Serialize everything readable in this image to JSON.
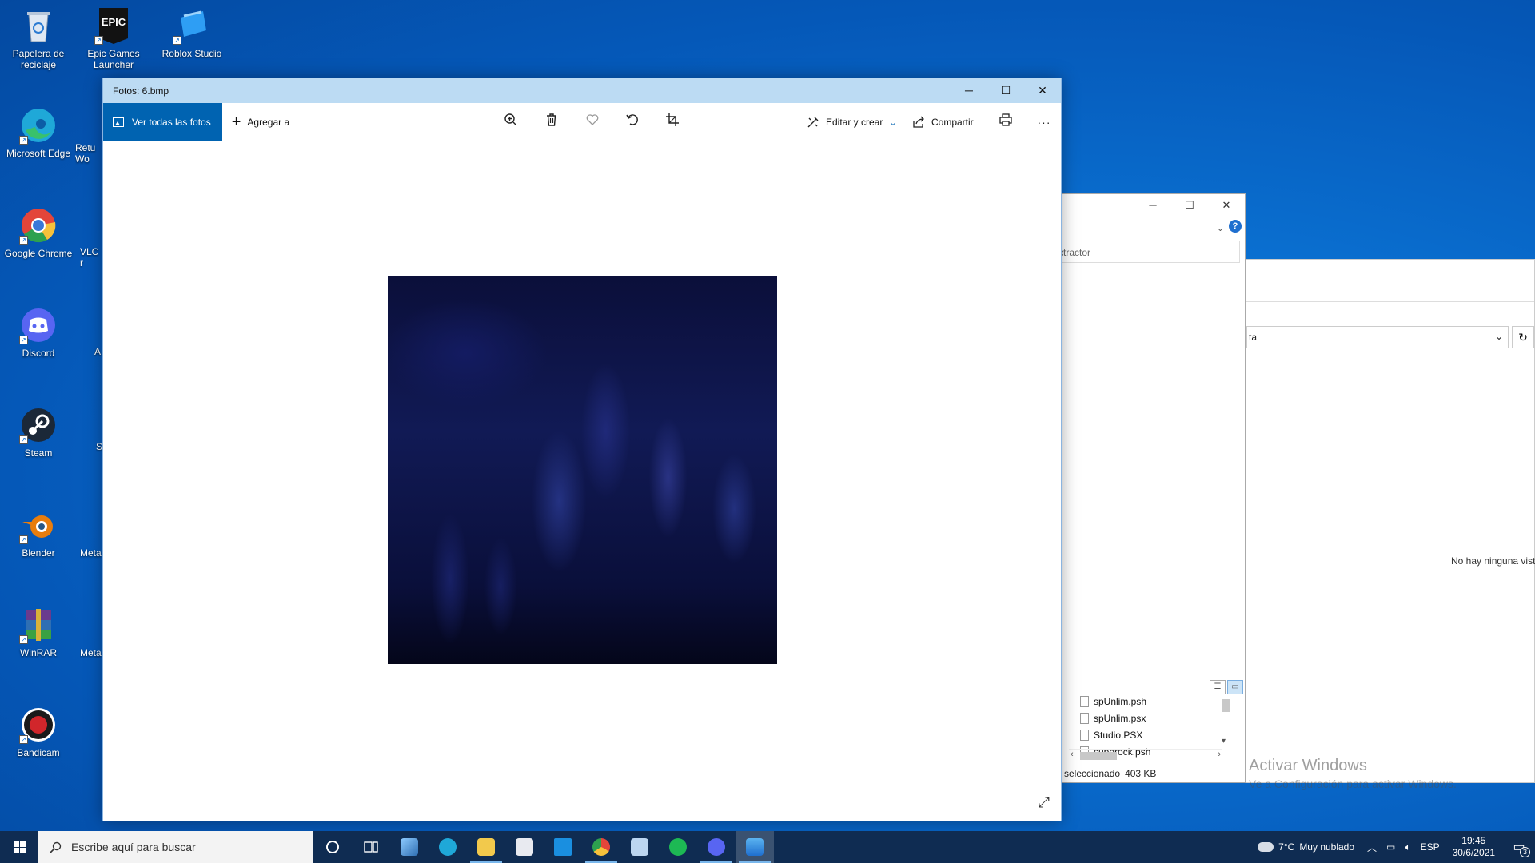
{
  "desktop": {
    "icons": [
      {
        "label": "Papelera de reciclaje",
        "icon": "recycle-bin-icon",
        "color": "#c9d6e6"
      },
      {
        "label": "Epic Games Launcher",
        "icon": "epic-games-icon",
        "color": "#121212"
      },
      {
        "label": "Roblox Studio",
        "icon": "roblox-studio-icon",
        "color": "#2e9ef4"
      },
      {
        "label": "Microsoft Edge",
        "icon": "edge-icon",
        "color": "#1fa8d8"
      },
      {
        "label": "Google Chrome",
        "icon": "chrome-icon",
        "color": "#e3453a"
      },
      {
        "label": "Discord",
        "icon": "discord-icon",
        "color": "#5865f2"
      },
      {
        "label": "Steam",
        "icon": "steam-icon",
        "color": "#1b2838"
      },
      {
        "label": "Blender",
        "icon": "blender-icon",
        "color": "#e87d0d"
      },
      {
        "label": "WinRAR",
        "icon": "winrar-icon",
        "color": "#6a3b8e"
      },
      {
        "label": "Bandicam",
        "icon": "bandicam-icon",
        "color": "#d1262b"
      }
    ],
    "partial_labels": [
      "Retu",
      "Wo",
      "VLC r",
      "A",
      "S",
      "Meta",
      "Meta"
    ],
    "epic_text": "EPIC"
  },
  "photos": {
    "title": "Fotos: 6.bmp",
    "view_all_label": "Ver todas las fotos",
    "add_to_label": "Agregar a",
    "edit_create_label": "Editar y crear",
    "share_label": "Compartir",
    "accent": "#0063b1"
  },
  "explorer": {
    "search_text": "xtractor",
    "files": [
      "spUnlim.psh",
      "spUnlim.psx",
      "Studio.PSX",
      "superock.psh"
    ],
    "status_text": "o seleccionado",
    "status_size": "403 KB"
  },
  "preview_window": {
    "combo_text": "ta",
    "message": "No hay ninguna vist",
    "activate_title": "Activar Windows",
    "activate_sub": "Ve a Configuración para activar Windows."
  },
  "taskbar": {
    "search_placeholder": "Escribe aquí para buscar",
    "weather_temp": "7°C",
    "weather_text": "Muy nublado",
    "language": "ESP",
    "time": "19:45",
    "date": "30/6/2021",
    "notification_count": "3"
  }
}
